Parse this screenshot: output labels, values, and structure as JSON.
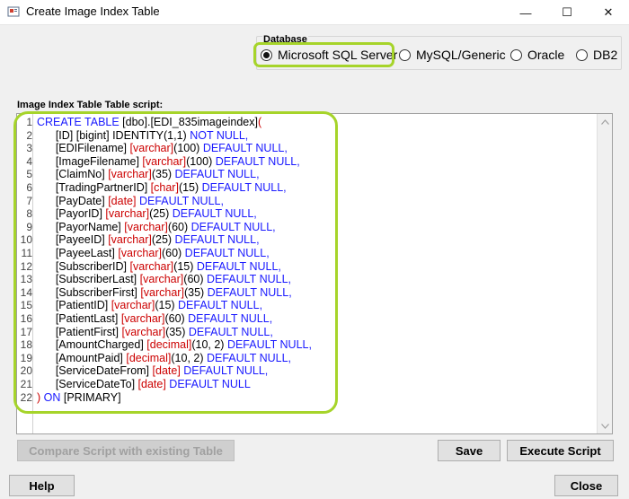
{
  "window": {
    "title": "Create Image Index Table",
    "minimize": "—",
    "maximize": "☐",
    "close": "✕"
  },
  "database": {
    "legend": "Database",
    "options": [
      {
        "label": "Microsoft SQL Server",
        "checked": true
      },
      {
        "label": "MySQL/Generic",
        "checked": false
      },
      {
        "label": "Oracle",
        "checked": false
      },
      {
        "label": "DB2",
        "checked": false
      }
    ],
    "highlight_color": "#a6d42a"
  },
  "script": {
    "label": "Image Index Table Table script:",
    "keyword_color": "#1a1aff",
    "type_color": "#cc0000",
    "lines": [
      {
        "n": "1",
        "t": [
          [
            "kw",
            "CREATE TABLE "
          ],
          [
            "id",
            "[dbo]."
          ],
          [
            "id",
            "[EDI_835imageindex]"
          ],
          [
            "ty",
            "("
          ]
        ]
      },
      {
        "n": "2",
        "t": [
          [
            "id",
            "      [ID] [bigint] "
          ],
          [
            "id",
            "IDENTITY"
          ],
          [
            "id",
            "(1,1) "
          ],
          [
            "kw",
            "NOT NULL,"
          ]
        ]
      },
      {
        "n": "3",
        "t": [
          [
            "id",
            "      [EDIFilename] "
          ],
          [
            "ty",
            "[varchar]"
          ],
          [
            "id",
            "(100) "
          ],
          [
            "kw",
            "DEFAULT NULL,"
          ]
        ]
      },
      {
        "n": "4",
        "t": [
          [
            "id",
            "      [ImageFilename] "
          ],
          [
            "ty",
            "[varchar]"
          ],
          [
            "id",
            "(100) "
          ],
          [
            "kw",
            "DEFAULT NULL,"
          ]
        ]
      },
      {
        "n": "5",
        "t": [
          [
            "id",
            "      [ClaimNo] "
          ],
          [
            "ty",
            "[varchar]"
          ],
          [
            "id",
            "(35) "
          ],
          [
            "kw",
            "DEFAULT NULL,"
          ]
        ]
      },
      {
        "n": "6",
        "t": [
          [
            "id",
            "      [TradingPartnerID] "
          ],
          [
            "ty",
            "[char]"
          ],
          [
            "id",
            "(15) "
          ],
          [
            "kw",
            "DEFAULT NULL,"
          ]
        ]
      },
      {
        "n": "7",
        "t": [
          [
            "id",
            "      [PayDate] "
          ],
          [
            "ty",
            "[date] "
          ],
          [
            "kw",
            "DEFAULT NULL,"
          ]
        ]
      },
      {
        "n": "8",
        "t": [
          [
            "id",
            "      [PayorID] "
          ],
          [
            "ty",
            "[varchar]"
          ],
          [
            "id",
            "(25) "
          ],
          [
            "kw",
            "DEFAULT NULL,"
          ]
        ]
      },
      {
        "n": "9",
        "t": [
          [
            "id",
            "      [PayorName] "
          ],
          [
            "ty",
            "[varchar]"
          ],
          [
            "id",
            "(60) "
          ],
          [
            "kw",
            "DEFAULT NULL,"
          ]
        ]
      },
      {
        "n": "10",
        "t": [
          [
            "id",
            "      [PayeeID] "
          ],
          [
            "ty",
            "[varchar]"
          ],
          [
            "id",
            "(25) "
          ],
          [
            "kw",
            "DEFAULT NULL,"
          ]
        ]
      },
      {
        "n": "11",
        "t": [
          [
            "id",
            "      [PayeeLast] "
          ],
          [
            "ty",
            "[varchar]"
          ],
          [
            "id",
            "(60) "
          ],
          [
            "kw",
            "DEFAULT NULL,"
          ]
        ]
      },
      {
        "n": "12",
        "t": [
          [
            "id",
            "      [SubscriberID] "
          ],
          [
            "ty",
            "[varchar]"
          ],
          [
            "id",
            "(15) "
          ],
          [
            "kw",
            "DEFAULT NULL,"
          ]
        ]
      },
      {
        "n": "13",
        "t": [
          [
            "id",
            "      [SubscriberLast] "
          ],
          [
            "ty",
            "[varchar]"
          ],
          [
            "id",
            "(60) "
          ],
          [
            "kw",
            "DEFAULT NULL,"
          ]
        ]
      },
      {
        "n": "14",
        "t": [
          [
            "id",
            "      [SubscriberFirst] "
          ],
          [
            "ty",
            "[varchar]"
          ],
          [
            "id",
            "(35) "
          ],
          [
            "kw",
            "DEFAULT NULL,"
          ]
        ]
      },
      {
        "n": "15",
        "t": [
          [
            "id",
            "      [PatientID] "
          ],
          [
            "ty",
            "[varchar]"
          ],
          [
            "id",
            "(15) "
          ],
          [
            "kw",
            "DEFAULT NULL,"
          ]
        ]
      },
      {
        "n": "16",
        "t": [
          [
            "id",
            "      [PatientLast] "
          ],
          [
            "ty",
            "[varchar]"
          ],
          [
            "id",
            "(60) "
          ],
          [
            "kw",
            "DEFAULT NULL,"
          ]
        ]
      },
      {
        "n": "17",
        "t": [
          [
            "id",
            "      [PatientFirst] "
          ],
          [
            "ty",
            "[varchar]"
          ],
          [
            "id",
            "(35) "
          ],
          [
            "kw",
            "DEFAULT NULL,"
          ]
        ]
      },
      {
        "n": "18",
        "t": [
          [
            "id",
            "      [AmountCharged] "
          ],
          [
            "ty",
            "[decimal]"
          ],
          [
            "id",
            "(10, 2) "
          ],
          [
            "kw",
            "DEFAULT NULL,"
          ]
        ]
      },
      {
        "n": "19",
        "t": [
          [
            "id",
            "      [AmountPaid] "
          ],
          [
            "ty",
            "[decimal]"
          ],
          [
            "id",
            "(10, 2) "
          ],
          [
            "kw",
            "DEFAULT NULL,"
          ]
        ]
      },
      {
        "n": "20",
        "t": [
          [
            "id",
            "      [ServiceDateFrom] "
          ],
          [
            "ty",
            "[date] "
          ],
          [
            "kw",
            "DEFAULT NULL,"
          ]
        ]
      },
      {
        "n": "21",
        "t": [
          [
            "id",
            "      [ServiceDateTo] "
          ],
          [
            "ty",
            "[date] "
          ],
          [
            "kw",
            "DEFAULT NULL"
          ]
        ]
      },
      {
        "n": "22",
        "t": [
          [
            "ty",
            ") "
          ],
          [
            "kw",
            "ON "
          ],
          [
            "id",
            "[PRIMARY]"
          ]
        ]
      }
    ]
  },
  "buttons": {
    "compare": "Compare Script with existing Table",
    "save": "Save",
    "execute": "Execute Script",
    "help": "Help",
    "close": "Close"
  }
}
